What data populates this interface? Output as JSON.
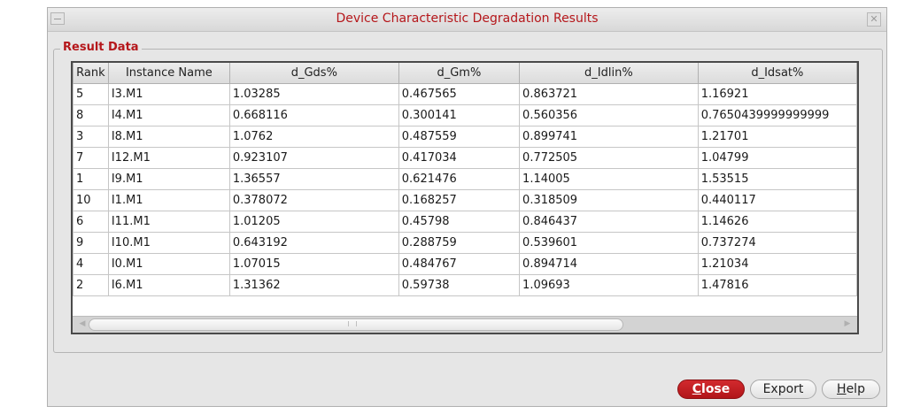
{
  "window": {
    "title": "Device Characteristic Degradation Results",
    "close_glyph": "✕"
  },
  "group": {
    "label": "Result Data"
  },
  "table": {
    "columns": [
      "Rank",
      "Instance Name",
      "d_Gds%",
      "d_Gm%",
      "d_Idlin%",
      "d_Idsat%"
    ],
    "rows": [
      [
        "5",
        "I3.M1",
        "1.03285",
        "0.467565",
        "0.863721",
        "1.16921"
      ],
      [
        "8",
        "I4.M1",
        "0.668116",
        "0.300141",
        "0.560356",
        "0.7650439999999999"
      ],
      [
        "3",
        "I8.M1",
        "1.0762",
        "0.487559",
        "0.899741",
        "1.21701"
      ],
      [
        "7",
        "I12.M1",
        "0.923107",
        "0.417034",
        "0.772505",
        "1.04799"
      ],
      [
        "1",
        "I9.M1",
        "1.36557",
        "0.621476",
        "1.14005",
        "1.53515"
      ],
      [
        "10",
        "I1.M1",
        "0.378072",
        "0.168257",
        "0.318509",
        "0.440117"
      ],
      [
        "6",
        "I11.M1",
        "1.01205",
        "0.45798",
        "0.846437",
        "1.14626"
      ],
      [
        "9",
        "I10.M1",
        "0.643192",
        "0.288759",
        "0.539601",
        "0.737274"
      ],
      [
        "4",
        "I0.M1",
        "1.07015",
        "0.484767",
        "0.894714",
        "1.21034"
      ],
      [
        "2",
        "I6.M1",
        "1.31362",
        "0.59738",
        "1.09693",
        "1.47816"
      ]
    ]
  },
  "scrollbar": {
    "left_icon": "◀",
    "right_icon": "▶",
    "icon_names": [
      "arrow-left-icon",
      "arrow-right-icon"
    ]
  },
  "buttons": {
    "close_mnemonic": "C",
    "close_rest": "lose",
    "export": "Export",
    "help_mnemonic": "H",
    "help_rest": "elp"
  },
  "colors": {
    "accent": "#b5171b",
    "close_button": "#c41f23"
  }
}
